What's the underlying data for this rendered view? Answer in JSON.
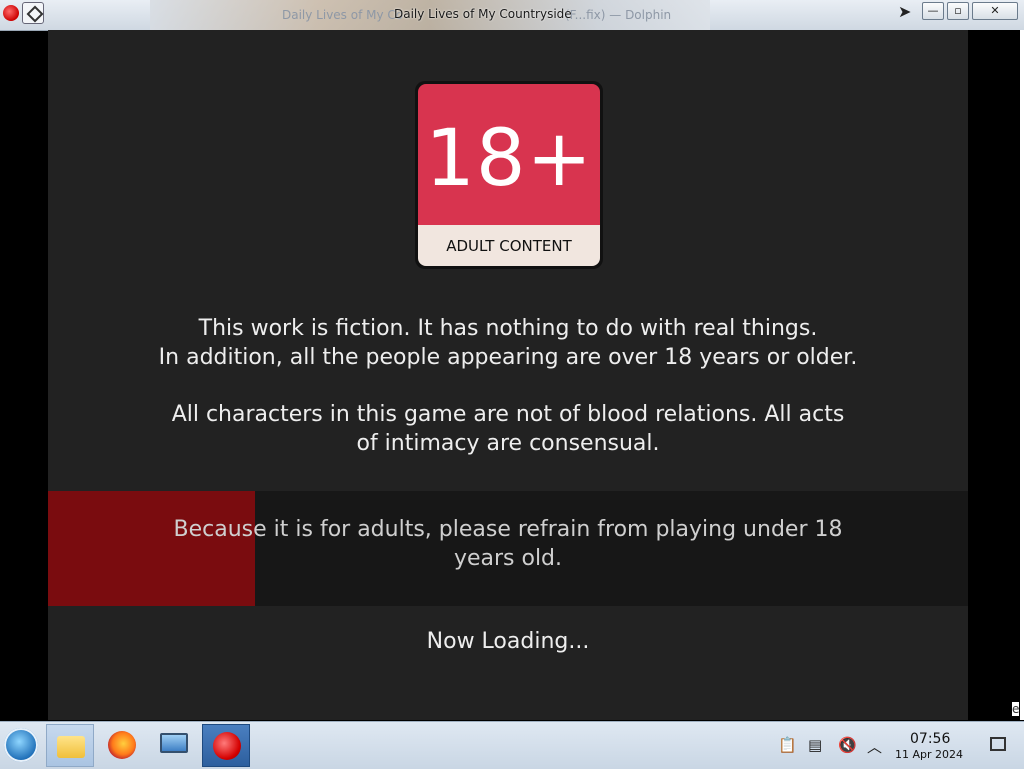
{
  "window": {
    "title": "Daily Lives of My Countryside",
    "title_faded": "Daily Lives of My Co",
    "title_faded_tail": "(F...fix) — Dolphin",
    "controls": {
      "minimize": "—",
      "maximize": "▫",
      "close": "✕"
    }
  },
  "game": {
    "badge": {
      "big": "18+",
      "caption": "ADULT CONTENT",
      "color": "#d8344f"
    },
    "notice_line1": "This work is fiction. It has nothing to do with real things.",
    "notice_line2": "In addition, all the people appearing are over 18 years or older.",
    "relations_line1": "All characters in this game are not of blood relations. All acts",
    "relations_line2": "of intimacy are consensual.",
    "warning_line1": "Because it is for adults, please refrain from playing under 18",
    "warning_line2": "years old.",
    "loading_progress": 0.225,
    "loading_text": "Now Loading...",
    "side_tip": "e"
  },
  "taskbar": {
    "items": [
      {
        "name": "file-manager",
        "icon": "folder-icon"
      },
      {
        "name": "firefox",
        "icon": "firefox-icon"
      },
      {
        "name": "system-settings",
        "icon": "monitor-icon"
      },
      {
        "name": "game-app",
        "icon": "apple-icon"
      }
    ],
    "tray": [
      "clipboard-icon",
      "notes-icon",
      "volume-muted-icon",
      "chevron-up-icon"
    ],
    "clock": {
      "time": "07:56",
      "date": "11 Apr 2024"
    }
  }
}
